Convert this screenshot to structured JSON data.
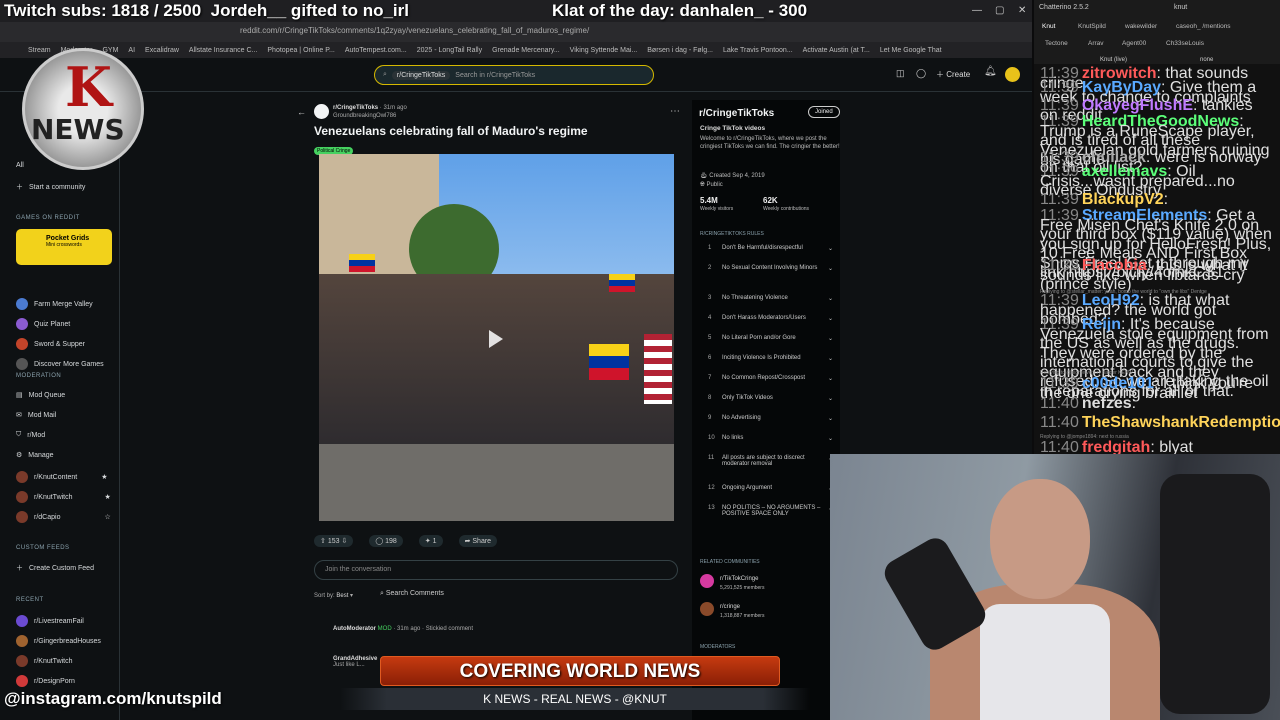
{
  "overlay": {
    "subs": "Twitch subs: 1818 / 2500",
    "gift": "Jordeh__ gifted to no_irl",
    "klat": "Klat of the day: danhalen_ - 300",
    "instagram": "@instagram.com/knutspild",
    "banner_title": "COVERING WORLD NEWS",
    "banner_sub": "K NEWS - REAL NEWS - @KNUT",
    "logo_letter": "K",
    "logo_word": "NEWS"
  },
  "browser": {
    "url": "reddit.com/r/CringeTikToks/comments/1q2zyay/venezuelans_celebrating_fall_of_maduros_regime/",
    "bookmarks": [
      "Stream",
      "Moderator",
      "GYM",
      "AI",
      "Excalidraw",
      "Allstate Insurance C...",
      "Photopea | Online P...",
      "AutoTempest.com...",
      "2025 - LongTail Rally",
      "Grenade Mercenary...",
      "Viking Syttende Mai...",
      "Børsen i dag - Følg...",
      "Lake Travis Pontoon...",
      "Activate Austin (at T...",
      "Let Me Google That"
    ]
  },
  "reddit": {
    "search_chip": "r/CringeTikToks",
    "search_placeholder": "Search in r/CringeTikToks",
    "create": "Create",
    "sidebar": {
      "all": "All",
      "start_community": "Start a community",
      "games_head": "GAMES ON REDDIT",
      "pocket_title": "Pocket Grids",
      "pocket_sub": "Mini crosswords",
      "games": [
        "Farm Merge Valley",
        "Quiz Planet",
        "Sword & Supper",
        "Discover More Games"
      ],
      "mod_head": "MODERATION",
      "mod": [
        "Mod Queue",
        "Mod Mail",
        "r/Mod",
        "Manage",
        "r/KnutContent",
        "r/KnutTwitch",
        "r/dCapio"
      ],
      "feeds_head": "CUSTOM FEEDS",
      "create_feed": "Create Custom Feed",
      "recent_head": "RECENT",
      "recent": [
        "r/LivestreamFail",
        "r/GingerbreadHouses",
        "r/KnutTwitch",
        "r/DesignPorn"
      ]
    },
    "post": {
      "subreddit": "r/CringeTikToks",
      "age": "· 31m ago",
      "author": "GroundbreakingOwl786",
      "title": "Venezuelans celebrating fall of Maduro's regime",
      "flair": "Political Cringe",
      "votes": "153",
      "comments": "198",
      "awards": "1",
      "share": "Share",
      "join_placeholder": "Join the conversation",
      "sort_label": "Sort by:",
      "sort_value": "Best",
      "search_comments": "Search Comments",
      "comment1_author": "AutoModerator",
      "comment1_tag": "MOD",
      "comment1_meta": "· 31m ago · Stickied comment",
      "comment2_author": "GrandAdhesive",
      "comment2_text": "Just like L..."
    },
    "community": {
      "title": "r/CringeTikToks",
      "joined": "Joined",
      "name": "Cringe TikTok videos",
      "description": "Welcome to r/CringeTikToks, where we post the cringiest TikToks we can find. The cringier the better!",
      "created": "Created Sep 4, 2019",
      "public": "Public",
      "visitors": "5.4M",
      "visitors_label": "Weekly visitors",
      "contrib": "62K",
      "contrib_label": "Weekly contributions",
      "rules_head": "R/CRINGETIKTOKS RULES",
      "rules": [
        "Don't Be Harmful/disrespectful",
        "No Sexual Content Involving Minors",
        "No Threatening Violence",
        "Don't Harass Moderators/Users",
        "No Literal Porn and/or Gore",
        "Inciting Violence Is Prohibited",
        "No Common Repost/Crosspost",
        "Only TikTok Videos",
        "No Advertising",
        "No links",
        "All posts are subject to discrect moderator removal",
        "Ongoing Argument",
        "NO POLITICS – NO ARGUMENTS – POSITIVE SPACE ONLY"
      ],
      "related_head": "RELATED COMMUNITIES",
      "related": [
        {
          "name": "r/TikTokCringe",
          "members": "5,291,525 members"
        },
        {
          "name": "r/cringe",
          "members": "1,318,887 members"
        }
      ],
      "moderators_head": "MODERATORS"
    }
  },
  "chat": {
    "app": "Chatterino 2.5.2",
    "channel": "knut",
    "tabs": [
      "Knut",
      "KnutSpild",
      "wakewilder",
      "caseoh_ /mentions",
      "Tectone",
      "Arrav",
      "Agent00",
      "Ch33seLouis"
    ],
    "live": "Knut (live)",
    "mode": "none",
    "messages": [
      {
        "time": "11:39",
        "user": "zitrowitch",
        "color": "#ff5a5a",
        "text": "that sounds cringe"
      },
      {
        "time": "11:39",
        "user": "KayByDay",
        "color": "#5aa9ff",
        "text": "Give them a week to change to complaints"
      },
      {
        "time": "11:39",
        "user": "OkayegFlushE",
        "color": "#c07aff",
        "text": "tankies on reddit"
      },
      {
        "time": "11:39",
        "user": "HeardTheGoodNews",
        "color": "#5cff7a",
        "text": "Trump is a RuneScape player, and is tired of all these Venezuelan gold farmers ruining his game"
      },
      {
        "time": "11:39",
        "user": "chullack",
        "color": "#aaaaaa",
        "text": "were is norway on that oil list?"
      },
      {
        "time": "11:39",
        "user": "axellemavs",
        "color": "#5cff7a",
        "text": "Oil Crisis...wasnt prepared...no diverse Ondustry"
      },
      {
        "time": "11:39",
        "user": "BlackupV2",
        "color": "#ffd45a",
        "text": ""
      },
      {
        "time": "11:39",
        "user": "StreamElements",
        "color": "#5aa9ff",
        "text": "Get a Free Misen Chef's Knife 2.0 on your third box ($119 value) when you sign up for HelloFresh! Plus, 10 Free Meals AND First Box Ships Free! Get it through my link https://bit.ly/4omkCS1"
      },
      {
        "time": "11:39",
        "user": "Flacobia",
        "color": "#ff5a5a",
        "text": "this is what it sounds like when libtards cry (prince style)"
      },
      {
        "time": "",
        "user": "",
        "color": "#888888",
        "text": "Replying to @stellar_matter: yeah, bomb the world to \"own the libs\" Dentge"
      },
      {
        "time": "11:39",
        "user": "LeoH92",
        "color": "#5aa9ff",
        "text": "is that what happened? the world got bombed?"
      },
      {
        "time": "11:39",
        "user": "Reijn",
        "color": "#5aa9ff",
        "text": "It's because Venezuela stole equipment from the US as well as the drugs. They were ordered by the international courts to give the equipment back and they refused. So we are taking the oil in reparations for all of that."
      },
      {
        "time": "",
        "user": "",
        "color": "#888888",
        "text": "Replying to @nightelve: cry harder KEKW"
      },
      {
        "time": "11:39",
        "user": "c00de101",
        "color": "#5aa9ff",
        "text": "I think you're the one crying brainlet"
      },
      {
        "time": "11:40",
        "user": "nefzes",
        "color": "#dddddd",
        "text": ""
      },
      {
        "time": "11:40",
        "user": "TheShawshankRedemption",
        "color": "#ffd45a",
        "text": ""
      },
      {
        "time": "",
        "user": "",
        "color": "#888888",
        "text": "Replying to @jompe1894: next to russia"
      },
      {
        "time": "11:40",
        "user": "fredgitah",
        "color": "#ff5a5a",
        "text": "blyat"
      }
    ]
  }
}
